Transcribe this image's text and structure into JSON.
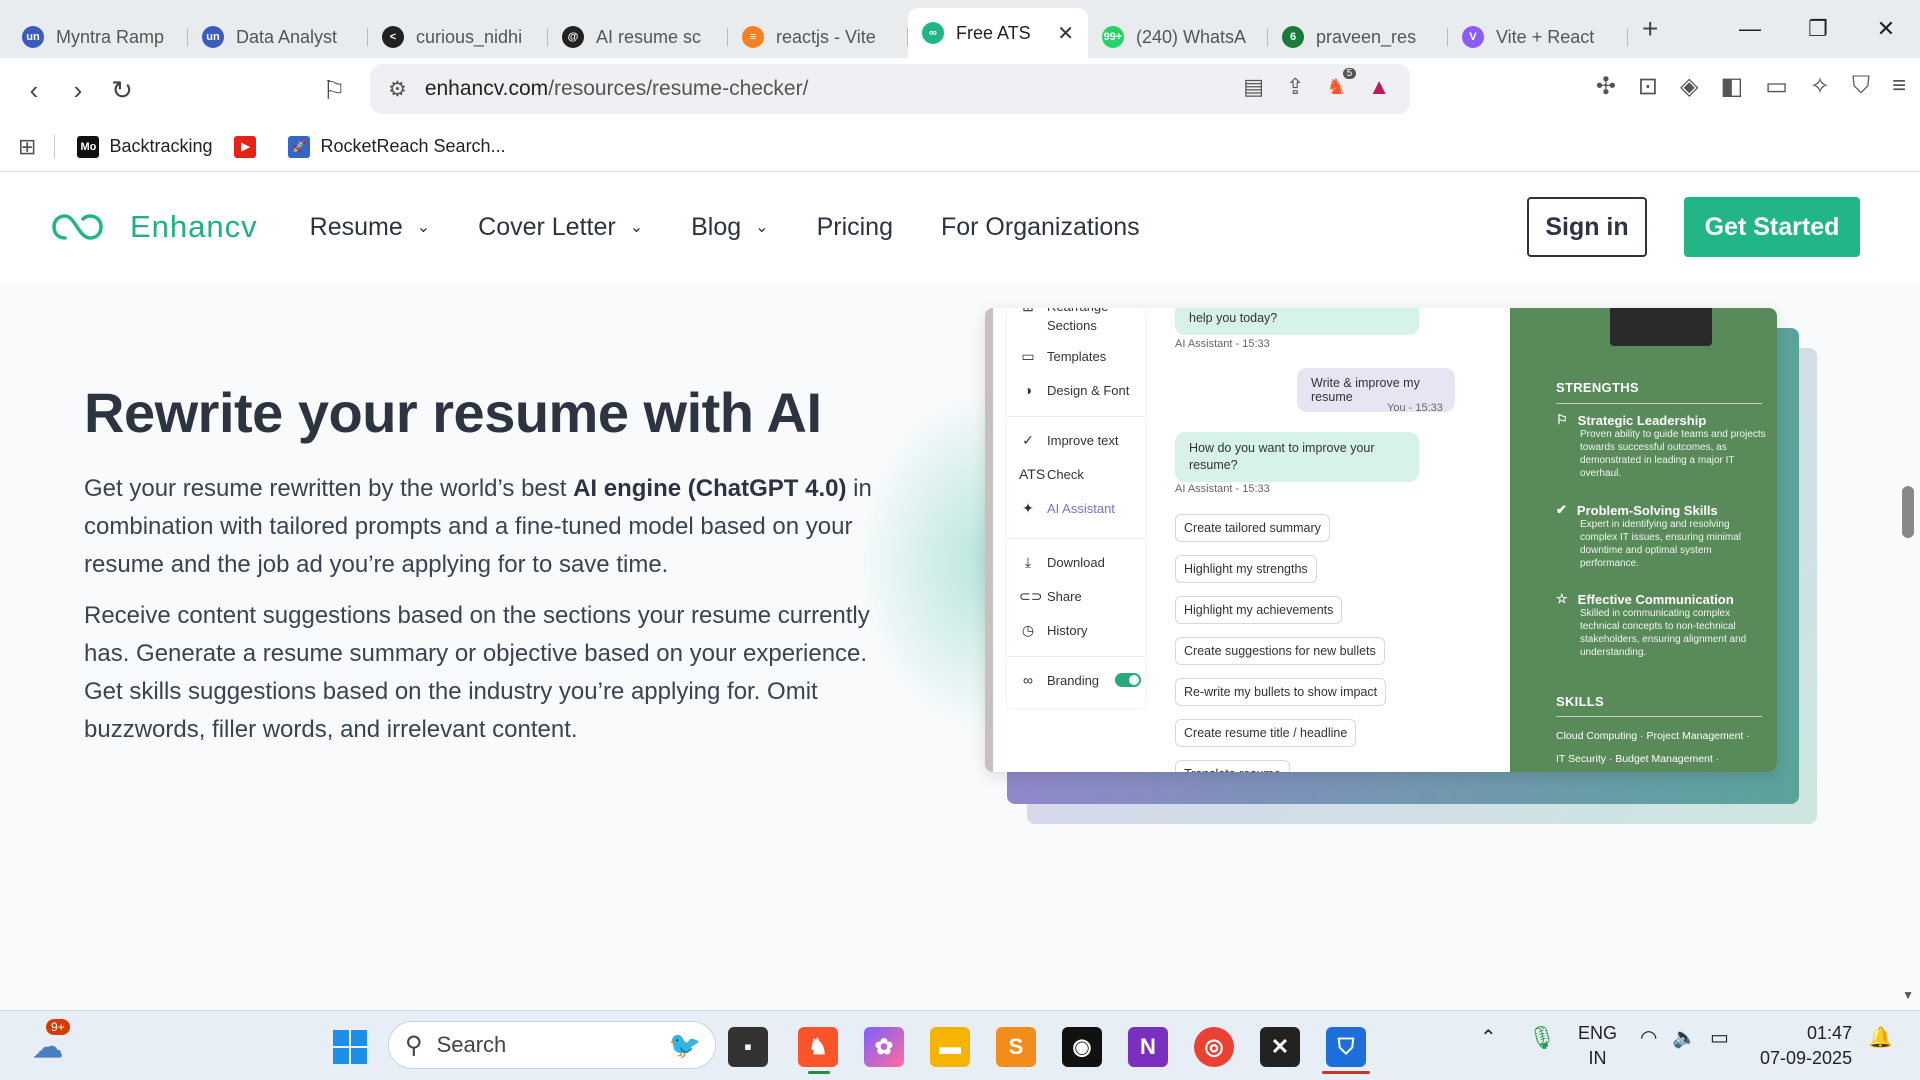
{
  "browser": {
    "tabs": [
      {
        "label": "Myntra Ramp",
        "fav_text": "un",
        "fav_color": "#3b5bbf"
      },
      {
        "label": "Data Analyst",
        "fav_text": "un",
        "fav_color": "#3b5bbf"
      },
      {
        "label": "curious_nidhi",
        "fav_text": "<",
        "fav_color": "#222222"
      },
      {
        "label": "AI resume sc",
        "fav_text": "@",
        "fav_color": "#222222"
      },
      {
        "label": "reactjs - Vite",
        "fav_text": "≡",
        "fav_color": "#f48024"
      },
      {
        "label": "Free ATS",
        "fav_text": "∞",
        "fav_color": "#21b587",
        "active": true
      },
      {
        "label": "(240) WhatsA",
        "fav_text": "99+",
        "fav_color": "#25d366"
      },
      {
        "label": "praveen_res",
        "fav_text": "6",
        "fav_color": "#1a7a3a"
      },
      {
        "label": "Vite + React",
        "fav_text": "V",
        "fav_color": "#8b5cf6"
      }
    ],
    "close_tab": "✕",
    "new_tab": "+",
    "url_host": "enhancv.com",
    "url_path": "/resources/resume-checker/",
    "brave_badge": "5",
    "bookmarks": [
      {
        "label": "Backtracking",
        "ico": "Mo",
        "color": "#111111"
      },
      {
        "label": "",
        "ico": "▶",
        "color": "#e62117"
      },
      {
        "label": "RocketReach Search...",
        "ico": "🚀",
        "color": "#3466c7"
      }
    ]
  },
  "site": {
    "logo_text": "Enhancv",
    "brand_color": "#21b587",
    "nav": [
      {
        "label": "Resume",
        "dropdown": true
      },
      {
        "label": "Cover Letter",
        "dropdown": true
      },
      {
        "label": "Blog",
        "dropdown": true
      },
      {
        "label": "Pricing",
        "dropdown": false
      },
      {
        "label": "For Organizations",
        "dropdown": false
      }
    ],
    "sign_in": "Sign in",
    "get_started": "Get Started"
  },
  "hero": {
    "title": "Rewrite your resume with AI",
    "p1_a": "Get your resume rewritten by the world’s best ",
    "p1_bold": "AI engine (ChatGPT 4.0)",
    "p1_b": " in combination with tailored prompts and a fine-tuned model based on your resume and the job ad you’re applying for to save time.",
    "p2": "Receive content suggestions based on the sections your resume currently has. Generate a resume summary or objective based on your experience. Get skills suggestions based on the industry you’re applying for. Omit buzzwords, filler words, and irrelevant content."
  },
  "mockup": {
    "sidebar": [
      {
        "label": "Rearrange",
        "icon": "⊞"
      },
      {
        "label": "Sections",
        "icon": ""
      },
      {
        "label": "Templates",
        "icon": "▭"
      },
      {
        "label": "Design & Font",
        "icon": "◑"
      },
      {
        "label": "Improve text",
        "icon": "✓"
      },
      {
        "label": "Check",
        "icon": "ATS"
      },
      {
        "label": "AI Assistant",
        "icon": "✦"
      },
      {
        "label": "Download",
        "icon": "⤓"
      },
      {
        "label": "Share",
        "icon": "⊂⊃"
      },
      {
        "label": "History",
        "icon": "◷"
      },
      {
        "label": "Branding",
        "icon": "∞"
      }
    ],
    "chat": {
      "bot_msg_1": "help you today?",
      "meta_1": "AI Assistant - 15:33",
      "user_msg": "Write & improve my resume",
      "user_meta": "You - 15:33",
      "bot_msg_2": "How do you want to improve your resume?",
      "meta_2": "AI Assistant - 15:33",
      "suggestions": [
        "Create tailored summary",
        "Highlight my strengths",
        "Highlight my achievements",
        "Create suggestions for new bullets",
        "Re-write my bullets to show impact",
        "Create resume title / headline",
        "Translate resume"
      ]
    },
    "resume": {
      "strengths_heading": "STRENGTHS",
      "strengths": [
        {
          "title": "Strategic Leadership",
          "icon": "⚐",
          "desc": "Proven ability to guide teams and projects towards successful outcomes, as demonstrated in leading a major IT overhaul."
        },
        {
          "title": "Problem-Solving Skills",
          "icon": "✔",
          "desc": "Expert in identifying and resolving complex IT issues, ensuring minimal downtime and optimal system performance."
        },
        {
          "title": "Effective Communication",
          "icon": "☆",
          "desc": "Skilled in communicating complex technical concepts to non-technical stakeholders, ensuring alignment and understanding."
        }
      ],
      "skills_heading": "SKILLS",
      "skills_line_1": "Cloud Computing · Project Management ·",
      "skills_line_2": "IT Security · Budget Management ·"
    }
  },
  "taskbar": {
    "search_placeholder": "Search",
    "weather_badge": "9+",
    "lang_1": "ENG",
    "lang_2": "IN",
    "time": "01:47",
    "date": "07-09-2025"
  }
}
